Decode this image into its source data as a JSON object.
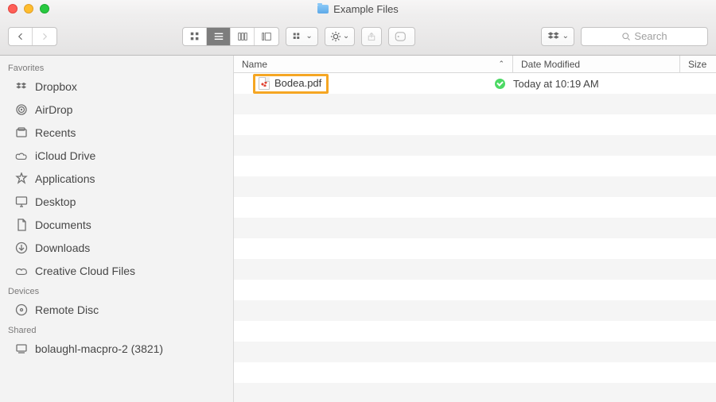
{
  "window": {
    "title": "Example Files"
  },
  "toolbar": {
    "search_placeholder": "Search"
  },
  "sidebar": {
    "sections": [
      {
        "label": "Favorites",
        "items": [
          {
            "name": "Dropbox",
            "icon": "dropbox-icon"
          },
          {
            "name": "AirDrop",
            "icon": "airdrop-icon"
          },
          {
            "name": "Recents",
            "icon": "recents-icon"
          },
          {
            "name": "iCloud Drive",
            "icon": "icloud-icon"
          },
          {
            "name": "Applications",
            "icon": "applications-icon"
          },
          {
            "name": "Desktop",
            "icon": "desktop-icon"
          },
          {
            "name": "Documents",
            "icon": "documents-icon"
          },
          {
            "name": "Downloads",
            "icon": "downloads-icon"
          },
          {
            "name": "Creative Cloud Files",
            "icon": "creative-cloud-icon"
          }
        ]
      },
      {
        "label": "Devices",
        "items": [
          {
            "name": "Remote Disc",
            "icon": "remote-disc-icon"
          }
        ]
      },
      {
        "label": "Shared",
        "items": [
          {
            "name": "bolaughl-macpro-2 (3821)",
            "icon": "shared-computer-icon"
          }
        ]
      }
    ]
  },
  "columns": {
    "name": "Name",
    "date": "Date Modified",
    "size": "Size"
  },
  "files": [
    {
      "name": "Bodea.pdf",
      "date": "Today at 10:19 AM",
      "synced": true,
      "highlighted": true
    }
  ]
}
